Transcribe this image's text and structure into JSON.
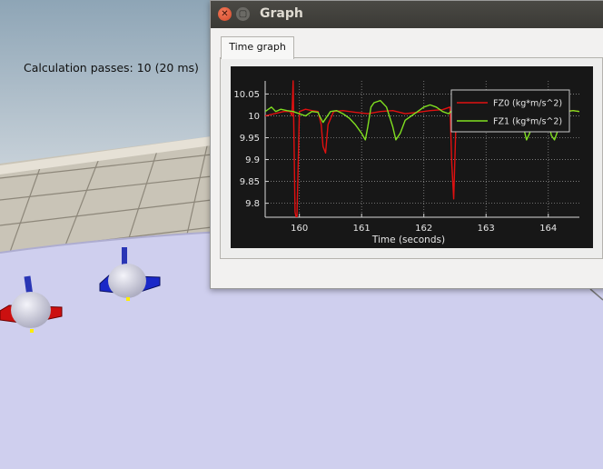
{
  "scene": {
    "calc_label": "Calculation passes: 10 (20 ms)"
  },
  "window": {
    "title": "Graph",
    "close_glyph": "✕",
    "max_glyph": "▢",
    "tab_label": "Time graph"
  },
  "chart_data": {
    "type": "line",
    "xlabel": "Time (seconds)",
    "ylabel": "",
    "xlim": [
      159.45,
      164.5
    ],
    "ylim": [
      9.768,
      10.08
    ],
    "xticks": [
      160,
      161,
      162,
      163,
      164
    ],
    "yticks": [
      9.8,
      9.85,
      9.9,
      9.95,
      10,
      10.05
    ],
    "ytick_labels": [
      "9.8",
      "9.85",
      "9.9",
      "9.95",
      "10",
      "10.05"
    ],
    "grid": true,
    "legend_position": "top-right",
    "series": [
      {
        "name": "FZ0 (kg*m/s^2)",
        "color": "#e01010",
        "x": [
          159.45,
          159.6,
          159.75,
          159.85,
          159.88,
          159.9,
          159.93,
          159.96,
          160.0,
          160.1,
          160.2,
          160.3,
          160.35,
          160.38,
          160.42,
          160.46,
          160.55,
          160.7,
          160.9,
          161.1,
          161.3,
          161.5,
          161.7,
          161.9,
          162.1,
          162.3,
          162.42,
          162.45,
          162.48,
          162.52,
          162.6,
          162.8,
          163.0,
          163.2,
          163.4,
          163.6,
          163.7,
          163.8,
          164.0,
          164.2,
          164.4,
          164.5
        ],
        "y": [
          10.0,
          10.005,
          10.01,
          10.01,
          10.0,
          10.08,
          9.78,
          9.76,
          10.01,
          10.015,
          10.012,
          10.01,
          9.98,
          9.93,
          9.915,
          9.98,
          10.01,
          10.012,
          10.008,
          10.005,
          10.01,
          10.012,
          10.005,
          10.008,
          10.012,
          10.014,
          10.02,
          9.89,
          9.81,
          10.0,
          10.012,
          10.01,
          10.01,
          10.01,
          10.012,
          10.01,
          10.02,
          10.01,
          10.012,
          10.01,
          10.012,
          10.01
        ]
      },
      {
        "name": "FZ1 (kg*m/s^2)",
        "color": "#80e020",
        "x": [
          159.45,
          159.55,
          159.62,
          159.7,
          159.8,
          159.9,
          160.1,
          160.2,
          160.3,
          160.33,
          160.38,
          160.5,
          160.6,
          160.7,
          160.8,
          160.9,
          161.0,
          161.06,
          161.1,
          161.15,
          161.2,
          161.3,
          161.4,
          161.5,
          161.55,
          161.62,
          161.7,
          161.8,
          161.9,
          162.0,
          162.1,
          162.2,
          162.3,
          162.4,
          162.5,
          162.6,
          162.7,
          162.8,
          162.9,
          163.0,
          163.1,
          163.2,
          163.3,
          163.4,
          163.5,
          163.6,
          163.65,
          163.7,
          163.75,
          163.8,
          163.9,
          164.0,
          164.05,
          164.1,
          164.15,
          164.2,
          164.3,
          164.4,
          164.5
        ],
        "y": [
          10.01,
          10.02,
          10.01,
          10.015,
          10.012,
          10.01,
          10.0,
          10.01,
          10.008,
          9.998,
          9.985,
          10.01,
          10.012,
          10.005,
          9.995,
          9.98,
          9.96,
          9.945,
          9.975,
          10.02,
          10.03,
          10.035,
          10.02,
          9.975,
          9.945,
          9.96,
          9.99,
          10.0,
          10.01,
          10.02,
          10.025,
          10.02,
          10.01,
          10.005,
          10.02,
          10.018,
          10.012,
          10.01,
          10.015,
          10.012,
          10.01,
          10.012,
          10.008,
          10.005,
          10.0,
          9.975,
          9.945,
          9.96,
          9.99,
          10.0,
          10.015,
          9.985,
          9.955,
          9.945,
          9.965,
          9.99,
          10.01,
          10.012,
          10.01
        ]
      }
    ]
  }
}
